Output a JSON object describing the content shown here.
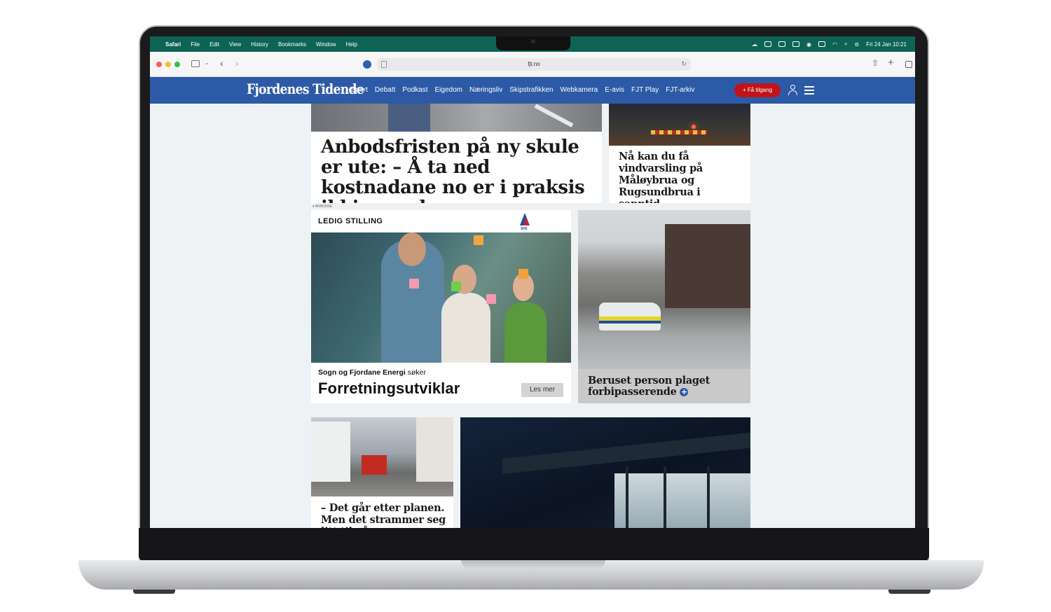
{
  "menubar": {
    "app": "Safari",
    "items": [
      "File",
      "Edit",
      "View",
      "History",
      "Bookmarks",
      "Window",
      "Help"
    ],
    "clock": "Fri 24 Jan  10:21"
  },
  "browser": {
    "url": "fjt.no"
  },
  "site": {
    "logo": "Fjordenes Tidende",
    "nav": [
      "Sport",
      "Debatt",
      "Podkast",
      "Eigedom",
      "Næringsliv",
      "Skipstrafikken",
      "Webkamera",
      "E-avis",
      "FJT Play",
      "FJT-arkiv"
    ],
    "cta": "+ Få tilgang",
    "accent": "#2d5aa6",
    "cta_color": "#c0141a"
  },
  "articles": [
    {
      "headline": "Anbodsfristen på ny skule er ute: – Å ta ned kostnadane no er i praksis ikkje mogleg"
    },
    {
      "headline": "Nå kan du få vindvarsling på Måløybrua og Rugsundbrua i sanntid"
    },
    {
      "headline": "Beruset person plaget forbipasserende"
    },
    {
      "headline": "– Det går etter planen. Men det strammer seg litt til på"
    }
  ],
  "ad": {
    "label": "ANNONSE",
    "title": "LEDIG STILLING",
    "logo_text": "SFE",
    "company": "Sogn og Fjordane Energi",
    "company_suffix": "søker",
    "role": "Forretningsutviklar",
    "button": "Les mer"
  }
}
